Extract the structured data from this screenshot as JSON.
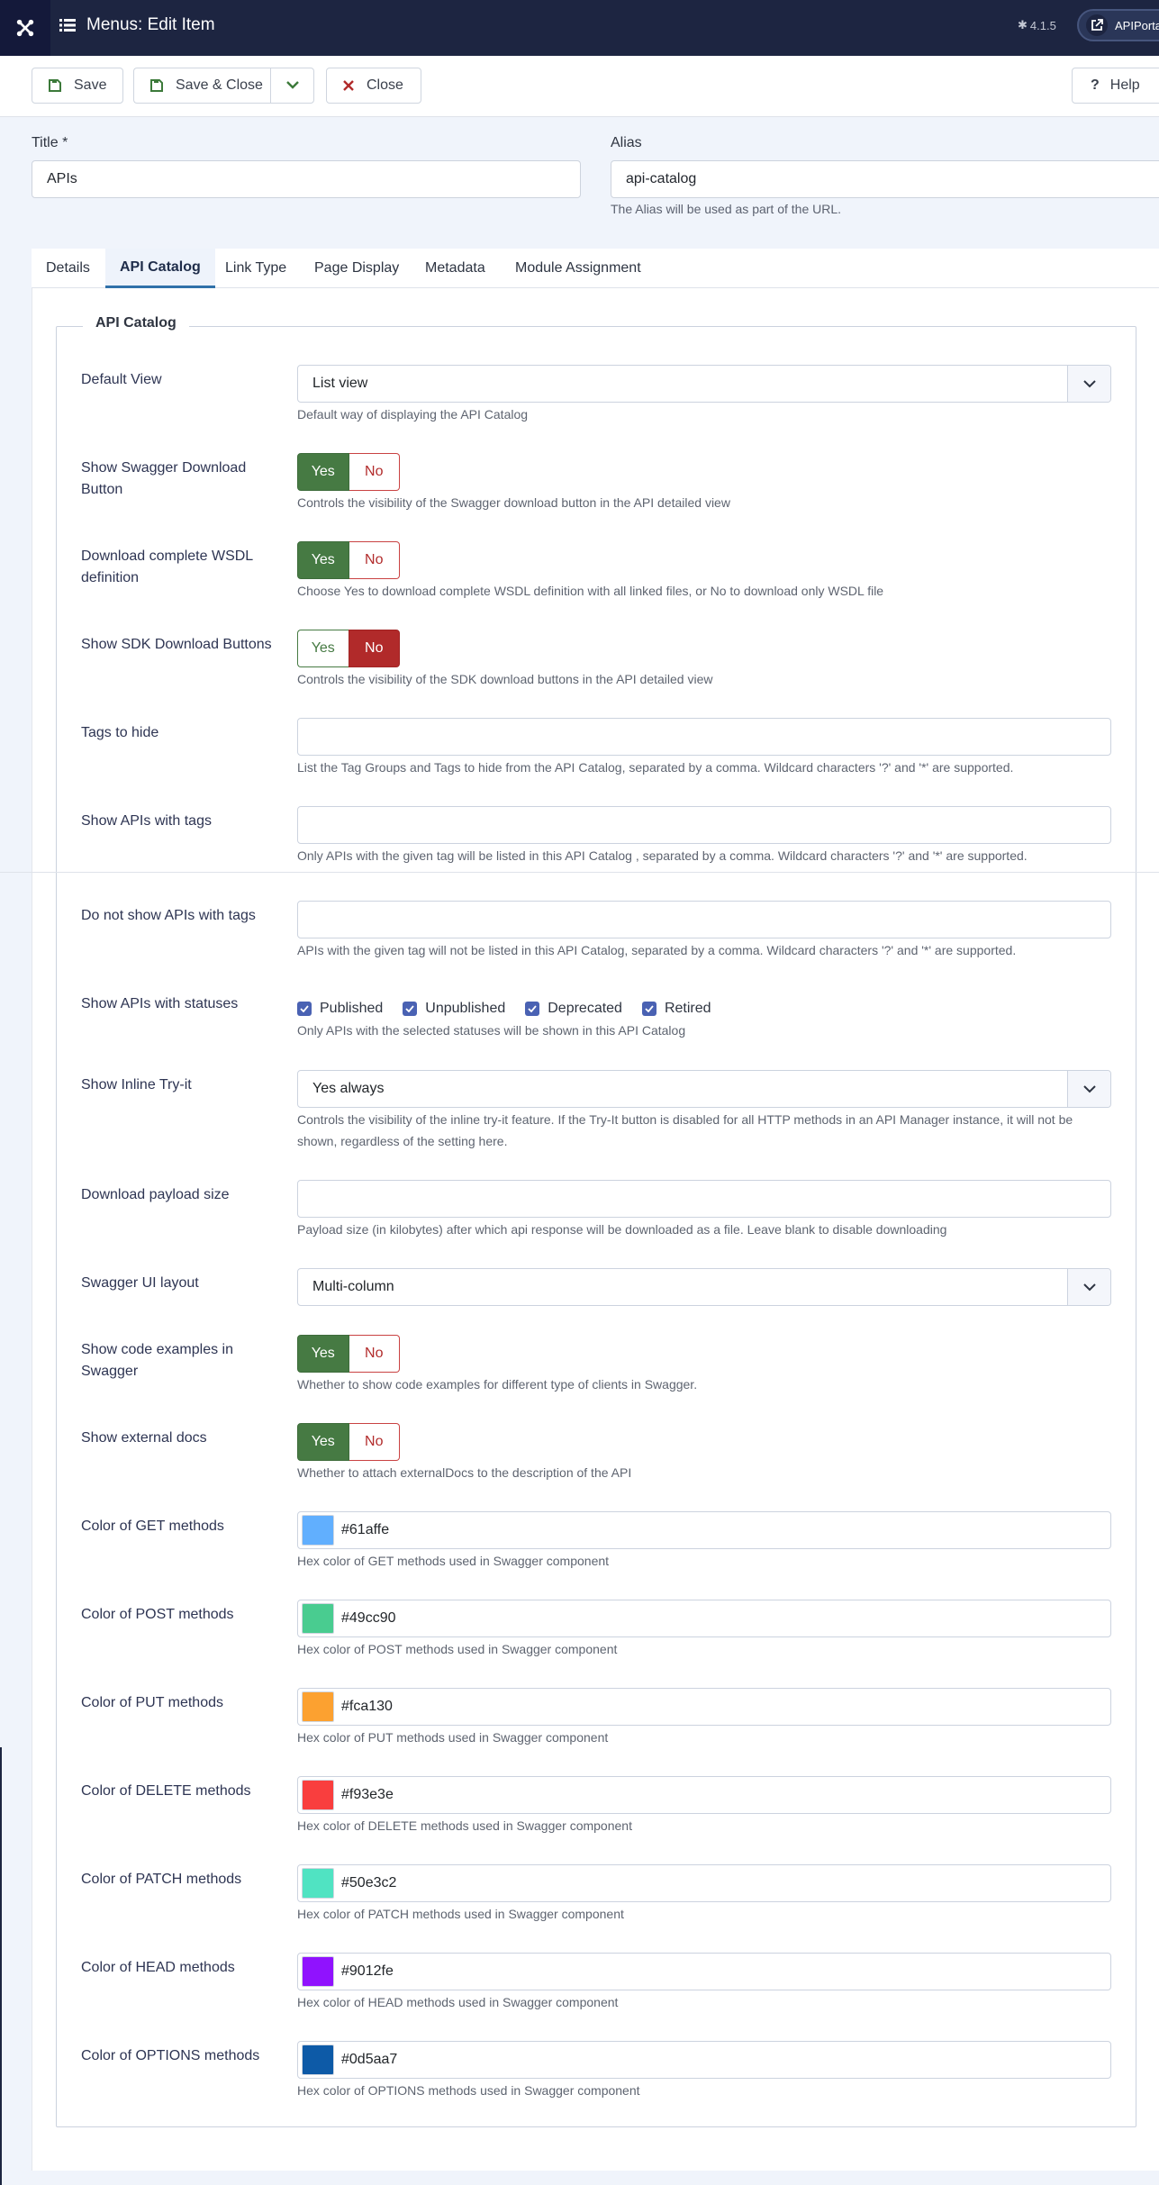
{
  "header": {
    "page_title": "Menus: Edit Item",
    "version": "4.1.5",
    "site_label": "APIPorta"
  },
  "toolbar": {
    "save_label": "Save",
    "save_close_label": "Save & Close",
    "close_label": "Close",
    "help_label": "Help"
  },
  "form": {
    "title_label": "Title *",
    "title_value": "APIs",
    "alias_label": "Alias",
    "alias_value": "api-catalog",
    "alias_hint": "The Alias will be used as part of the URL."
  },
  "tabs": [
    {
      "label": "Details"
    },
    {
      "label": "API Catalog"
    },
    {
      "label": "Link Type"
    },
    {
      "label": "Page Display"
    },
    {
      "label": "Metadata"
    },
    {
      "label": "Module Assignment"
    }
  ],
  "active_tab": "API Catalog",
  "fieldset_legend": "API Catalog",
  "fields": {
    "default_view": {
      "label": "Default View",
      "value": "List view",
      "desc": "Default way of displaying the API Catalog"
    },
    "swagger_download": {
      "label": "Show Swagger Download Button",
      "value": "Yes",
      "desc": "Controls the visibility of the Swagger download button in the API detailed view"
    },
    "wsdl": {
      "label": "Download complete WSDL definition",
      "value": "Yes",
      "desc": "Choose Yes to download complete WSDL definition with all linked files, or No to download only WSDL file"
    },
    "sdk": {
      "label": "Show SDK Download Buttons",
      "value": "No",
      "desc": "Controls the visibility of the SDK download buttons in the API detailed view"
    },
    "tags_hide": {
      "label": "Tags to hide",
      "value": "",
      "desc": "List the Tag Groups and Tags to hide from the API Catalog, separated by a comma. Wildcard characters '?' and '*' are supported."
    },
    "tags_show": {
      "label": "Show APIs with tags",
      "value": "",
      "desc": "Only APIs with the given tag will be listed in this API Catalog , separated by a comma. Wildcard characters '?' and '*' are supported."
    },
    "tags_not_show": {
      "label": "Do not show APIs with tags",
      "value": "",
      "desc": "APIs with the given tag will not be listed in this API Catalog, separated by a comma. Wildcard characters '?' and '*' are supported."
    },
    "statuses": {
      "label": "Show APIs with statuses",
      "options": [
        "Published",
        "Unpublished",
        "Deprecated",
        "Retired"
      ],
      "checked": [
        true,
        true,
        true,
        true
      ],
      "desc": "Only APIs with the selected statuses will be shown in this API Catalog"
    },
    "tryit": {
      "label": "Show Inline Try-it",
      "value": "Yes always",
      "desc": "Controls the visibility of the inline try-it feature. If the Try-It button is disabled for all HTTP methods in an API Manager instance, it will not be shown, regardless of the setting here."
    },
    "payload": {
      "label": "Download payload size",
      "value": "",
      "desc": "Payload size (in kilobytes) after which api response will be downloaded as a file. Leave blank to disable downloading"
    },
    "swagger_layout": {
      "label": "Swagger UI layout",
      "value": "Multi-column"
    },
    "code_examples": {
      "label": "Show code examples in Swagger",
      "value": "Yes",
      "desc": "Whether to show code examples for different type of clients in Swagger."
    },
    "external_docs": {
      "label": "Show external docs",
      "value": "Yes",
      "desc": "Whether to attach externalDocs to the description of the API"
    },
    "switch_yes": "Yes",
    "switch_no": "No"
  },
  "colors": [
    {
      "label": "Color of GET methods",
      "value": "#61affe",
      "desc": "Hex color of GET methods used in Swagger component"
    },
    {
      "label": "Color of POST methods",
      "value": "#49cc90",
      "desc": "Hex color of POST methods used in Swagger component"
    },
    {
      "label": "Color of PUT methods",
      "value": "#fca130",
      "desc": "Hex color of PUT methods used in Swagger component"
    },
    {
      "label": "Color of DELETE methods",
      "value": "#f93e3e",
      "desc": "Hex color of DELETE methods used in Swagger component"
    },
    {
      "label": "Color of PATCH methods",
      "value": "#50e3c2",
      "desc": "Hex color of PATCH methods used in Swagger component"
    },
    {
      "label": "Color of HEAD methods",
      "value": "#9012fe",
      "desc": "Hex color of HEAD methods used in Swagger component"
    },
    {
      "label": "Color of OPTIONS methods",
      "value": "#0d5aa7",
      "desc": "Hex color of OPTIONS methods used in Swagger component"
    }
  ]
}
